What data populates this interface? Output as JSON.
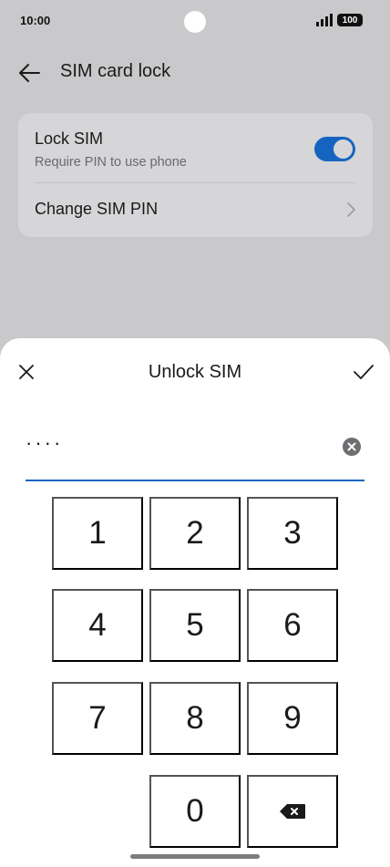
{
  "status_bar": {
    "time": "10:00",
    "battery": "100",
    "icons": [
      "camera-dot",
      "signal-icon",
      "battery-icon"
    ]
  },
  "header": {
    "title": "SIM card lock",
    "back_icon": "back-arrow-icon"
  },
  "settings": {
    "lock_sim": {
      "title": "Lock SIM",
      "subtitle": "Require PIN to use phone",
      "enabled": true
    },
    "change_pin": {
      "label": "Change SIM PIN",
      "icon": "chevron-right-icon"
    }
  },
  "dialog": {
    "title": "Unlock SIM",
    "close_icon": "close-icon",
    "confirm_icon": "checkmark-icon",
    "pin_value": "····",
    "clear_icon": "clear-circle-icon"
  },
  "keypad": {
    "keys": [
      "1",
      "2",
      "3",
      "4",
      "5",
      "6",
      "7",
      "8",
      "9",
      "0"
    ],
    "backspace_icon": "backspace-icon"
  },
  "colors": {
    "accent": "#1565c0",
    "scrim_background": "#c9c9cb",
    "card_background": "#d6d6d8",
    "sheet_background": "#ffffff"
  }
}
